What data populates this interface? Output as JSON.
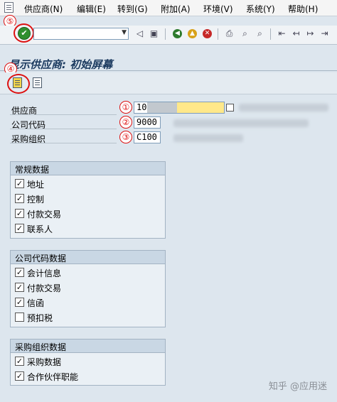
{
  "menubar": {
    "items": [
      "供应商(N)",
      "编辑(E)",
      "转到(G)",
      "附加(A)",
      "环境(V)",
      "系统(Y)",
      "帮助(H)"
    ]
  },
  "toolbar": {
    "ok_icon": "check-icon",
    "command_value": "",
    "icons": [
      "back-triangle-icon",
      "save-icon",
      "back-icon",
      "exit-icon",
      "cancel-icon",
      "print-icon",
      "find-icon",
      "find-next-icon",
      "first-page-icon",
      "prev-page-icon",
      "next-page-icon",
      "last-page-icon"
    ]
  },
  "title": "显示供应商: 初始屏幕",
  "annotations": [
    "①",
    "②",
    "③",
    "④",
    "⑤"
  ],
  "fields": [
    {
      "label": "供应商",
      "value": "10"
    },
    {
      "label": "公司代码",
      "value": "9000"
    },
    {
      "label": "采购组织",
      "value": "C100"
    }
  ],
  "groups": [
    {
      "title": "常规数据",
      "items": [
        {
          "label": "地址",
          "checked": true
        },
        {
          "label": "控制",
          "checked": true
        },
        {
          "label": "付款交易",
          "checked": true
        },
        {
          "label": "联系人",
          "checked": true
        }
      ]
    },
    {
      "title": "公司代码数据",
      "items": [
        {
          "label": "会计信息",
          "checked": true
        },
        {
          "label": "付款交易",
          "checked": true
        },
        {
          "label": "信函",
          "checked": true
        },
        {
          "label": "预扣税",
          "checked": false
        }
      ]
    },
    {
      "title": "采购组织数据",
      "items": [
        {
          "label": "采购数据",
          "checked": true
        },
        {
          "label": "合作伙伴职能",
          "checked": true
        }
      ]
    }
  ],
  "watermark": "知乎 @应用迷",
  "colors": {
    "annotation": "#d11111",
    "highlight": "#ffe88a",
    "ok_green": "#2f8f2f"
  }
}
